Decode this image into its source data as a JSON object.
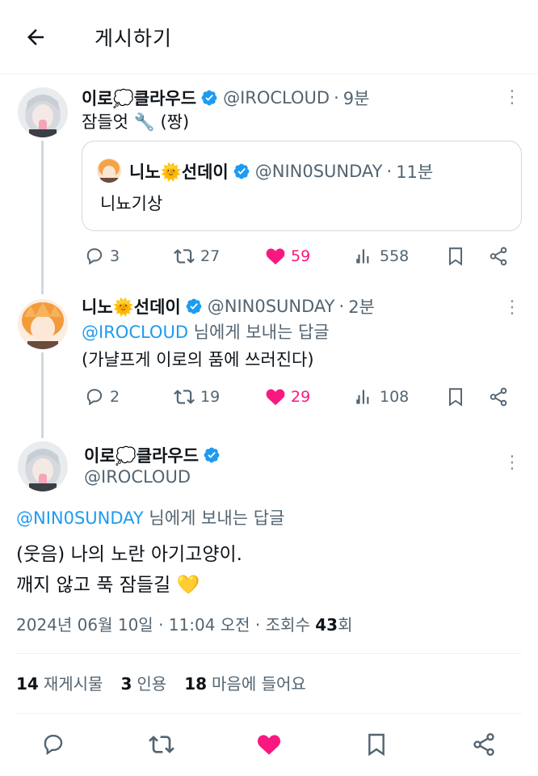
{
  "header": {
    "title": "게시하기"
  },
  "tweet1": {
    "display_name": "이로💭클라우드",
    "handle": "@IROCLOUD",
    "time": "9분",
    "text": "잠들엇 🔧 (짱)",
    "quote": {
      "display_name": "니노🌞선데이",
      "handle": "@NIN0SUNDAY",
      "time": "11분",
      "text": "니뇨기상"
    },
    "replies": "3",
    "retweets": "27",
    "likes": "59",
    "views": "558"
  },
  "tweet2": {
    "display_name": "니노🌞선데이",
    "handle": "@NIN0SUNDAY",
    "time": "2분",
    "reply_to_handle": "@IROCLOUD",
    "reply_to_suffix": " 님에게 보내는 답글",
    "text": "(가냘프게 이로의 품에 쓰러진다)",
    "replies": "2",
    "retweets": "19",
    "likes": "29",
    "views": "108"
  },
  "main_tweet": {
    "display_name": "이로💭클라우드",
    "handle": "@IROCLOUD",
    "reply_to_handle": "@NIN0SUNDAY",
    "reply_to_suffix": " 님에게 보내는 답글",
    "text_line1": "(웃음) 나의 노란 아기고양이.",
    "text_line2": "깨지 않고 푹 잠들길 💛",
    "timestamp": "2024년 06월 10일 · 11:04 오전 · 조회수 ",
    "views_count": "43",
    "views_suffix": "회",
    "reposts_count": "14",
    "reposts_label": "재게시물",
    "quotes_count": "3",
    "quotes_label": "인용",
    "likes_count": "18",
    "likes_label": "마음에 들어요"
  },
  "colors": {
    "accent": "#1d9bf0",
    "like": "#f91880",
    "secondary_text": "#536471",
    "border": "#cfd9de"
  },
  "icons": {
    "back": "arrow-left-icon",
    "verified": "verified-badge-icon",
    "reply": "reply-icon",
    "retweet": "retweet-icon",
    "like": "heart-icon",
    "views": "bar-chart-icon",
    "bookmark": "bookmark-icon",
    "share": "share-icon",
    "more": "more-vertical-icon"
  }
}
